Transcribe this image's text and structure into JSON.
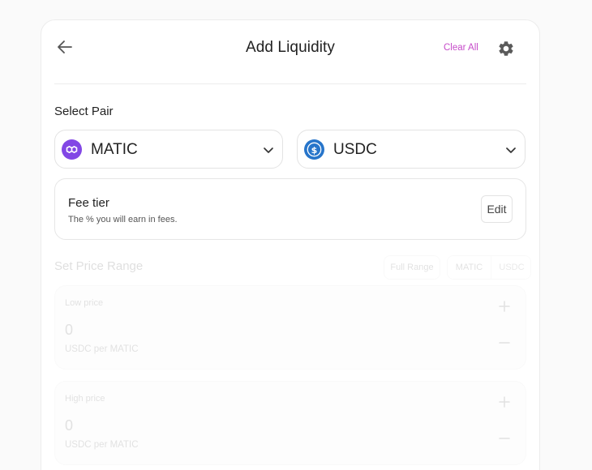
{
  "header": {
    "title": "Add Liquidity",
    "clear_all_label": "Clear All"
  },
  "pair": {
    "label": "Select Pair",
    "token_a": {
      "symbol": "MATIC",
      "icon": "matic-logo-icon",
      "color": "#8247e5"
    },
    "token_b": {
      "symbol": "USDC",
      "icon": "usdc-logo-icon",
      "color": "#2775ca"
    }
  },
  "fee": {
    "title": "Fee tier",
    "subtitle": "The % you will earn in fees.",
    "edit_label": "Edit"
  },
  "price_range": {
    "label": "Set Price Range",
    "full_range_label": "Full Range",
    "unit_options": [
      "MATIC",
      "USDC"
    ],
    "low": {
      "label": "Low price",
      "value": "0",
      "unit": "USDC per MATIC"
    },
    "high": {
      "label": "High price",
      "value": "0",
      "unit": "USDC per MATIC"
    }
  },
  "colors": {
    "accent": "#c64cc9"
  }
}
